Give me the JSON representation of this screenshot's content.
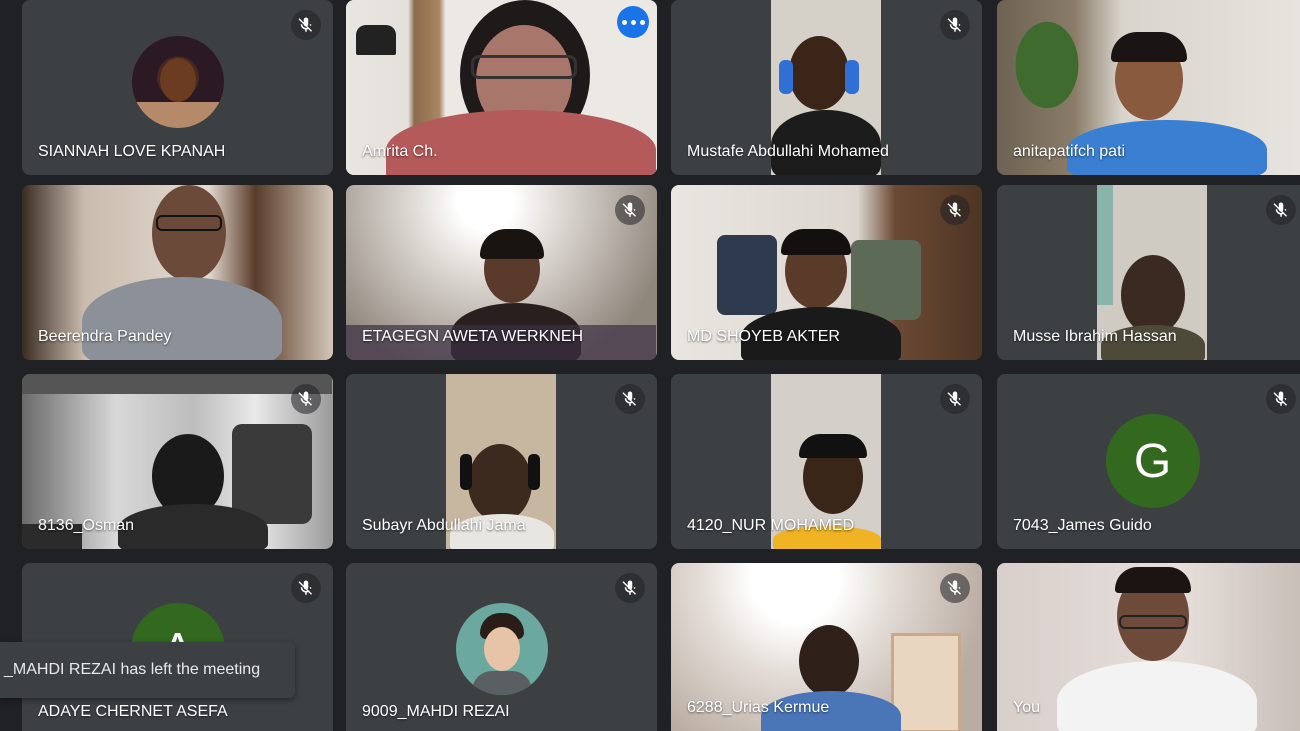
{
  "colors": {
    "background": "#202124",
    "tile": "#3c4043",
    "speaking_outline": "#8ab4f8",
    "more_button": "#1a73e8",
    "avatar_green": "#33691e"
  },
  "participants": [
    {
      "name": "SIANNAH LOVE KPANAH",
      "muted": true,
      "avatar": "photo"
    },
    {
      "name": "Amrita Ch.",
      "muted": false,
      "speaking": true
    },
    {
      "name": "Mustafe Abdullahi Mohamed",
      "muted": true
    },
    {
      "name": "anitapatifch pati",
      "muted": false
    },
    {
      "name": "Beerendra Pandey",
      "muted": false
    },
    {
      "name": "ETAGEGN AWETA WERKNEH",
      "muted": true
    },
    {
      "name": "MD SHOYEB AKTER",
      "muted": true
    },
    {
      "name": "Musse Ibrahim Hassan",
      "muted": true
    },
    {
      "name": "8136_Osman",
      "muted": true
    },
    {
      "name": "Subayr Abdullahi Jama",
      "muted": true
    },
    {
      "name": "4120_NUR MOHAMED",
      "muted": true
    },
    {
      "name": "7043_James Guido",
      "muted": true,
      "avatar_letter": "G"
    },
    {
      "name": "ADAYE CHERNET ASEFA",
      "muted": true,
      "avatar_letter": "A"
    },
    {
      "name": "9009_MAHDI REZAI",
      "muted": true,
      "avatar": "photo"
    },
    {
      "name": "6288_Urias Kermue",
      "muted": true
    },
    {
      "name": "You",
      "muted": false
    }
  ],
  "toast": {
    "text": "_MAHDI REZAI has left the meeting"
  },
  "icons": {
    "mic_off": "mic-off-icon",
    "more": "more-options-icon"
  }
}
